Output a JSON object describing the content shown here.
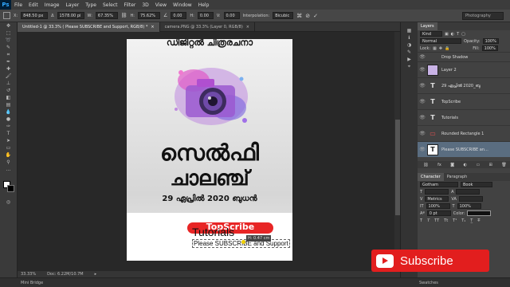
{
  "menubar": {
    "logo": "Ps",
    "items": [
      "File",
      "Edit",
      "Image",
      "Layer",
      "Type",
      "Select",
      "Filter",
      "3D",
      "View",
      "Window",
      "Help"
    ]
  },
  "options": {
    "x_label": "X:",
    "x_value": "848.50 px",
    "w_label": "W:",
    "w_value": "67.35%",
    "h_label": "H:",
    "h_value": "75.62%",
    "angle_value": "0.00",
    "hskew_label": "H:",
    "hskew_value": "0.00",
    "vskew_label": "V:",
    "vskew_value": "0.00",
    "interp_label": "Interpolation:",
    "interp_value": "Bicubic",
    "y_value": "1578.00 pi",
    "workspace": "Photography"
  },
  "tabs": [
    "Untitled-1 @ 33.3% ( Please SUBSCRIBE and Support, RGB/8) *",
    "camera.PNG @ 33.3% (Layer 0, RGB/8)"
  ],
  "document": {
    "top_text": "ഡിജിറ്റൽ ചിത്രരചനാ",
    "title_line1": "സെൽഫി",
    "title_line2": "ചാലഞ്ച്",
    "date_text": "29 ഏപ്രിൽ 2020 ബുധൻ",
    "button_text": "TopScribe",
    "tutorials_text": "Tutorials",
    "please_text": "Please SUBSCRIBE and Support",
    "tooltip": "H: 0.47 cm"
  },
  "status": {
    "zoom": "33.33%",
    "doc": "Doc: 6.22M/10.7M",
    "mini_bridge": "Mini Bridge"
  },
  "layers_panel": {
    "tab_label": "Layers",
    "kind_label": "Kind",
    "blend_mode": "Normal",
    "opacity_label": "Opacity:",
    "opacity_value": "100%",
    "lock_label": "Lock:",
    "fill_label": "Fill:",
    "fill_value": "100%",
    "layers": [
      {
        "name": "Drop Shadow"
      },
      {
        "name": "Layer 2"
      },
      {
        "name": "29 ഏപ്രിൽ 2020_ബു"
      },
      {
        "name": "TopScribe"
      },
      {
        "name": "Tutorials"
      },
      {
        "name": "Rounded Rectangle 1"
      },
      {
        "name": "Please SUBSCRIBE an..."
      }
    ]
  },
  "character_panel": {
    "tab_character": "Character",
    "tab_paragraph": "Paragraph",
    "font_family": "Gotham",
    "font_style": "Book",
    "metrics_label": "Metrics",
    "scale_v": "100%",
    "scale_h": "100%",
    "baseline": "0 pt",
    "color_label": "Color:"
  },
  "subscribe_overlay": {
    "label": "Subscribe",
    "color": "#e21e1e"
  },
  "bottom": {
    "swatches": "Swatches"
  }
}
